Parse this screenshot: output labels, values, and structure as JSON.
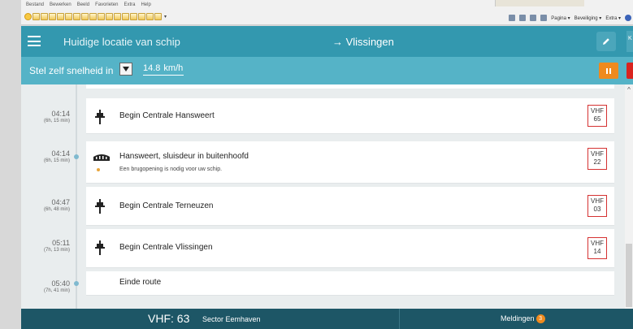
{
  "browser": {
    "menu": [
      "Bestand",
      "Bewerken",
      "Beeld",
      "Favorieten",
      "Extra",
      "Help"
    ],
    "toolbar": [
      "Pagina ▾",
      "Beveiliging ▾",
      "Extra ▾"
    ]
  },
  "header": {
    "title": "Huidige locatie van schip",
    "destination": "→ Vlissingen",
    "extra_label": "K"
  },
  "speedbar": {
    "label": "Stel zelf snelheid in",
    "value": "14.8",
    "unit": "km/h"
  },
  "route": [
    {
      "time": "04:14",
      "duration": "(6h, 15 min)",
      "name": "Begin Centrale Hansweert",
      "sub": "",
      "icon": "station-icon",
      "vhf_label": "VHF",
      "vhf_channel": "65"
    },
    {
      "time": "04:14",
      "duration": "(6h, 15 min)",
      "name": "Hansweert, sluisdeur in buitenhoofd",
      "sub": "Een brugopening is nodig voor uw schip.",
      "icon": "lock-gate-icon",
      "vhf_label": "VHF",
      "vhf_channel": "22"
    },
    {
      "time": "04:47",
      "duration": "(6h, 48 min)",
      "name": "Begin Centrale Terneuzen",
      "sub": "",
      "icon": "station-icon",
      "vhf_label": "VHF",
      "vhf_channel": "03"
    },
    {
      "time": "05:11",
      "duration": "(7h, 13 min)",
      "name": "Begin Centrale Vlissingen",
      "sub": "",
      "icon": "station-icon",
      "vhf_label": "VHF",
      "vhf_channel": "14"
    },
    {
      "time": "05:40",
      "duration": "(7h, 41 min)",
      "name": "Einde route",
      "sub": "",
      "icon": "",
      "vhf_label": "",
      "vhf_channel": ""
    }
  ],
  "footer": {
    "vhf": "VHF: 63",
    "sector": "Sector Eemhaven",
    "meldingen": "Meldingen",
    "meldingen_count": "3"
  },
  "colors": {
    "header": "#3398af",
    "speedbar": "#55b3c7",
    "footer": "#1d5666",
    "vhf_border": "#d53232",
    "pause": "#ef8a1e",
    "stop": "#d9241f"
  }
}
